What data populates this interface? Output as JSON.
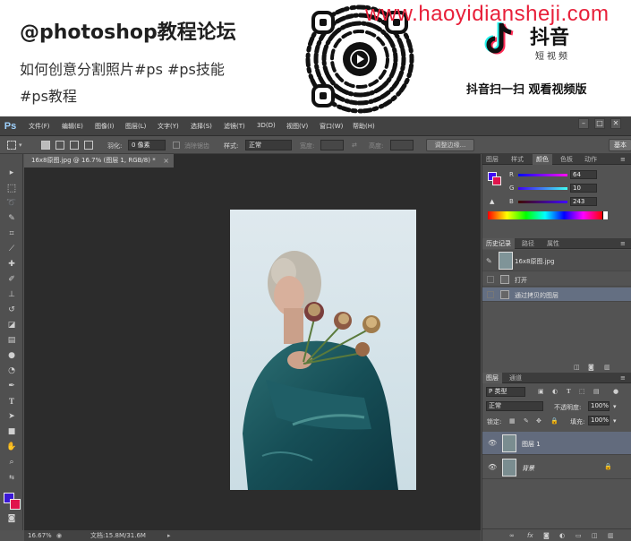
{
  "banner": {
    "handle": "@photoshop教程论坛",
    "desc_line1": "如何创意分割照片#ps #ps技能",
    "desc_line2": "#ps教程",
    "watermark": "www.haoyidiansheji.com",
    "brand_name": "抖音",
    "brand_sub": "短视频",
    "scan_hint": "抖音扫一扫 观看视频版",
    "colors": {
      "watermark": "#e8203a",
      "tiktok_cyan": "#25f4ee",
      "tiktok_red": "#fe2c55"
    }
  },
  "app": {
    "logo": "Ps",
    "menu": [
      "文件(F)",
      "编辑(E)",
      "图像(I)",
      "图层(L)",
      "文字(Y)",
      "选择(S)",
      "滤镜(T)",
      "3D(D)",
      "视图(V)",
      "窗口(W)",
      "帮助(H)"
    ],
    "window_controls": {
      "minimize": "–",
      "maximize": "□",
      "close": "✕"
    }
  },
  "options_bar": {
    "feather_label": "羽化:",
    "feather_value": "0 像素",
    "antialias_label": "消除锯齿",
    "style_label": "样式:",
    "style_value": "正常",
    "width_label": "宽度:",
    "height_label": "高度:",
    "refine_edge": "调整边缘...",
    "workspace": "基本"
  },
  "document": {
    "tab_title": "16x8原图.jpg @ 16.7% (图层 1, RGB/8) *",
    "tab_close": "×"
  },
  "status_bar": {
    "zoom": "16.67%",
    "doc_info": "文档:15.8M/31.6M"
  },
  "color_panel": {
    "tabs": [
      "图层",
      "样式",
      "颜色",
      "色板",
      "动作"
    ],
    "active_tab": "颜色",
    "r_label": "R",
    "r_value": "64",
    "g_label": "G",
    "g_value": "10",
    "b_label": "B",
    "b_value": "243",
    "fg_color": "#400af3",
    "bg_color": "#e0144c"
  },
  "history_panel": {
    "tabs": [
      "历史记录",
      "路径",
      "属性"
    ],
    "active_tab": "历史记录",
    "snapshot": "16x8原图.jpg",
    "items": [
      "打开",
      "通过拷贝的图层"
    ]
  },
  "layers_panel": {
    "tabs": [
      "图层",
      "通道"
    ],
    "active_tab": "图层",
    "filter_kind": "P 类型",
    "blend_mode": "正常",
    "opacity_label": "不透明度:",
    "opacity_value": "100%",
    "lock_label": "锁定:",
    "fill_label": "填充:",
    "fill_value": "100%",
    "layers": [
      {
        "name": "图层 1",
        "selected": true
      },
      {
        "name": "背景",
        "selected": false,
        "locked": true
      }
    ],
    "bottom_icons": [
      "link-icon",
      "fx-icon",
      "mask-icon",
      "adjustment-icon",
      "folder-icon",
      "new-layer-icon",
      "trash-icon"
    ]
  }
}
